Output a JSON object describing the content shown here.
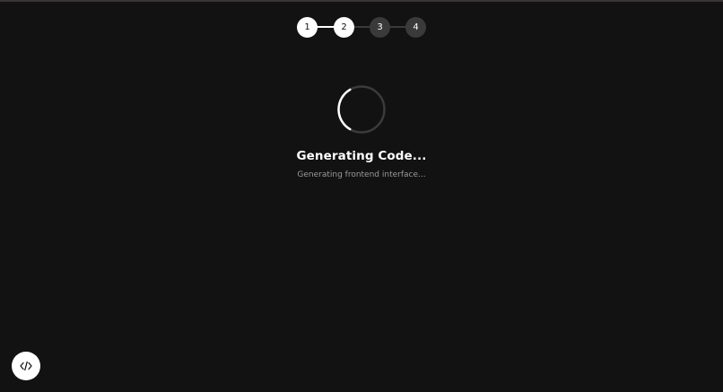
{
  "stepper": {
    "steps": [
      {
        "label": "1",
        "state": "done"
      },
      {
        "label": "2",
        "state": "active"
      },
      {
        "label": "3",
        "state": "pending"
      },
      {
        "label": "4",
        "state": "pending"
      }
    ]
  },
  "status": {
    "title": "Generating Code...",
    "subtitle": "Generating frontend interface..."
  },
  "code_button": {
    "icon": "code-icon"
  },
  "colors": {
    "background": "#121212",
    "step_active": "#ffffff",
    "step_pending": "#3a3a3a",
    "connector_done": "#ffffff",
    "connector_pending": "#3a3a3a",
    "subtitle": "#9a9a9a"
  }
}
